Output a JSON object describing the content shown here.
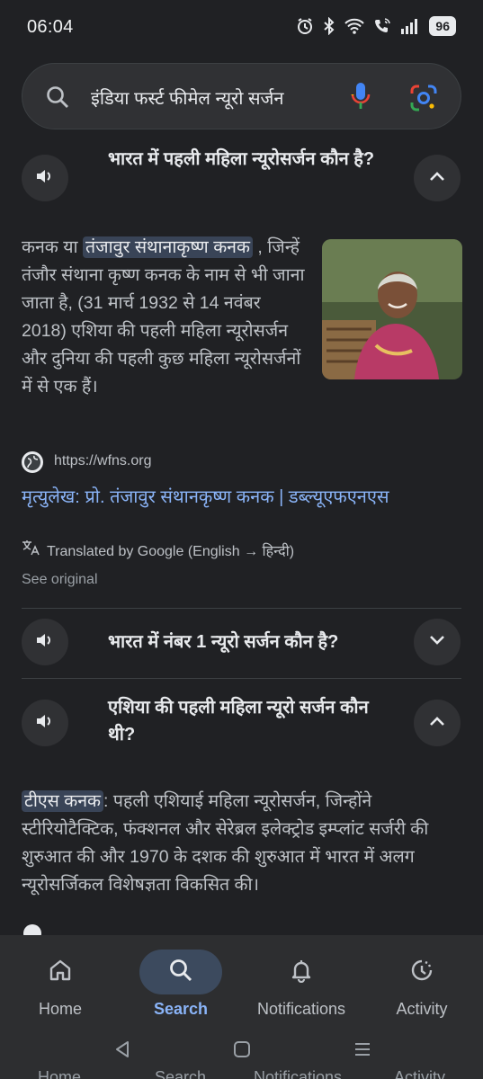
{
  "status_bar": {
    "time": "06:04",
    "battery": "96",
    "icons": [
      "alarm-icon",
      "bluetooth-icon",
      "wifi-icon",
      "wifi-call-icon",
      "signal-icon"
    ]
  },
  "search": {
    "query": "इंडिया फर्स्ट फीमेल न्यूरो सर्जन"
  },
  "qa": [
    {
      "question": "भारत में पहली महिला न्यूरोसर्जन कौन है?",
      "expanded": true,
      "answer_highlight": "तंजावुर संथानाकृष्ण कनक",
      "answer_prefix": "कनक या",
      "answer_rest": ", जिन्हें तंजौर संथाना कृष्ण कनक के नाम से भी जाना जाता है, (31 मार्च 1932 से 14 नवंबर 2018) एशिया की पहली महिला न्यूरोसर्जन और दुनिया की पहली कुछ महिला न्यूरोसर्जनों में से एक हैं।",
      "source_url": "https://wfns.org",
      "source_title": "मृत्युलेख: प्रो. तंजावुर संथानकृष्ण कनक | डब्ल्यूएफएनएस",
      "translated_by": "Translated by Google (English → हिन्दी)",
      "see_original": "See original"
    },
    {
      "question": "भारत में नंबर 1 न्यूरो सर्जन कौन है?",
      "expanded": false
    },
    {
      "question": "एशिया की पहली महिला न्यूरो सर्जन कौन थी?",
      "expanded": true,
      "answer_highlight": "टीएस कनक",
      "answer_rest": ": पहली एशियाई महिला न्यूरोसर्जन, जिन्होंने स्टीरियोटैक्टिक, फंक्शनल और सेरेब्रल इलेक्ट्रोड इम्प्लांट सर्जरी की शुरुआत की और 1970 के दशक की शुरुआत में भारत में अलग न्यूरोसर्जिकल विशेषज्ञता विकसित की।"
    }
  ],
  "bottom_nav": [
    {
      "label": "Home",
      "icon": "home-icon",
      "active": false
    },
    {
      "label": "Search",
      "icon": "search-icon",
      "active": true
    },
    {
      "label": "Notifications",
      "icon": "bell-icon",
      "active": false
    },
    {
      "label": "Activity",
      "icon": "activity-icon",
      "active": false
    }
  ],
  "system_nav": [
    "back-icon",
    "home-square-icon",
    "recents-icon"
  ],
  "colors": {
    "background": "#202124",
    "link": "#8ab4f8",
    "highlight": "#394457",
    "nav_bg": "#2d2e30"
  }
}
